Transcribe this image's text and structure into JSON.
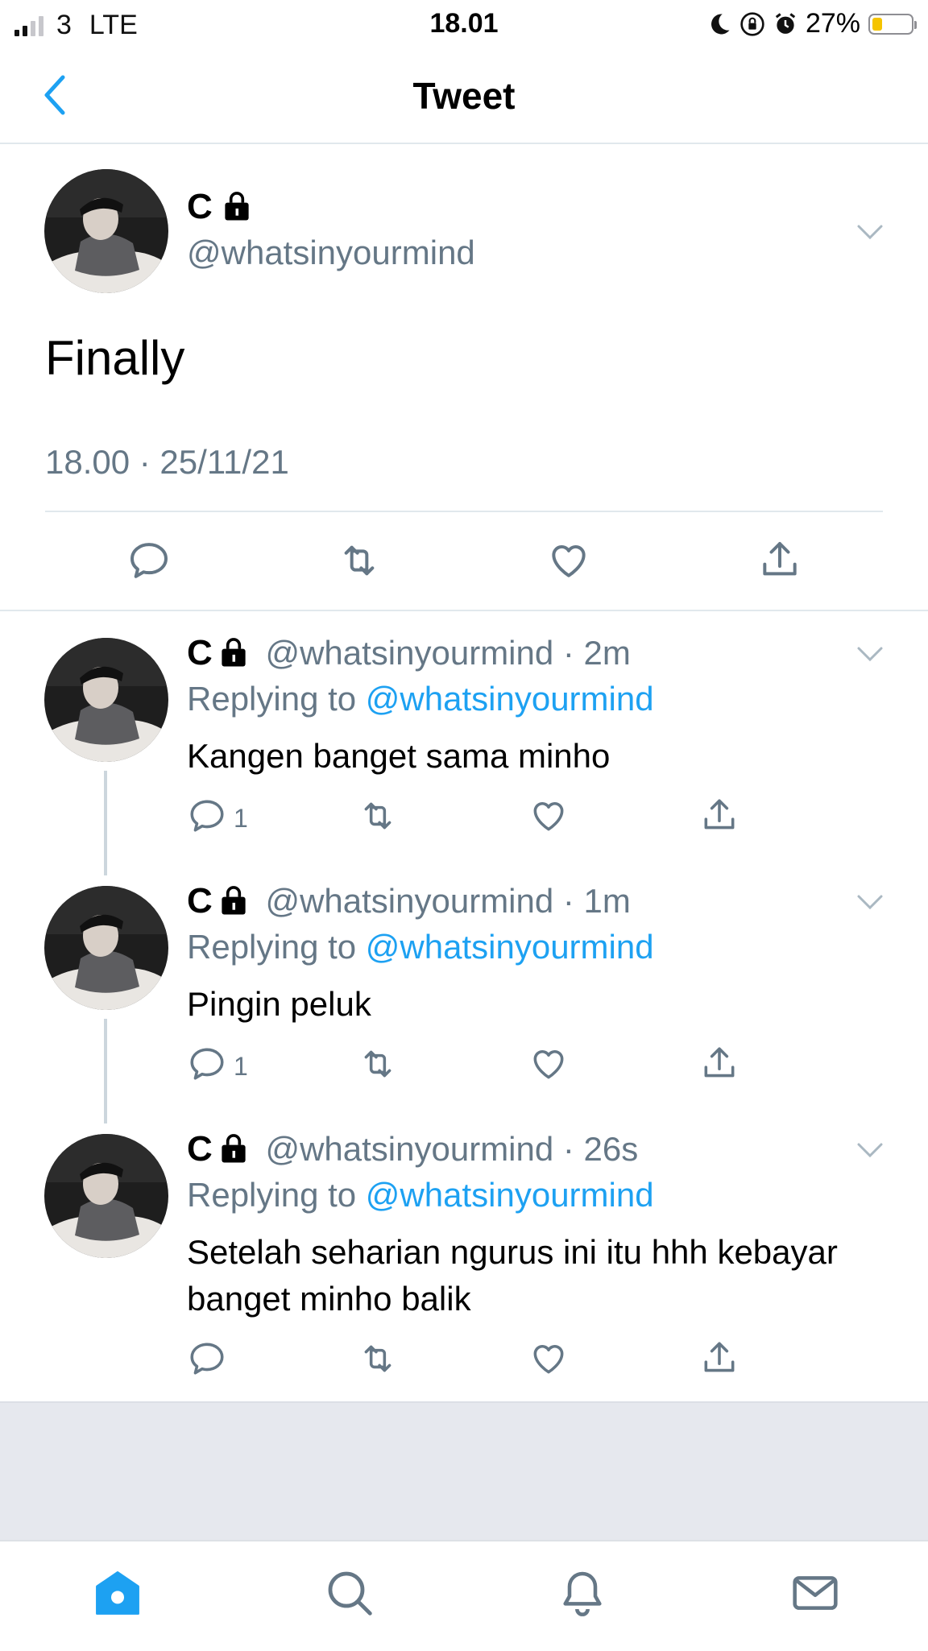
{
  "status_bar": {
    "carrier": "3",
    "network": "LTE",
    "time": "18.01",
    "battery_percent": "27%",
    "battery_level": 0.27,
    "battery_color": "#f5c400"
  },
  "nav": {
    "title": "Tweet",
    "back_icon": "chevron-left-icon"
  },
  "main_tweet": {
    "name": "C",
    "handle": "@whatsinyourmind",
    "text": "Finally",
    "timestamp": "18.00 · 25/11/21"
  },
  "replies": [
    {
      "name": "C",
      "handle": "@whatsinyourmind",
      "time": "· 2m",
      "replying_label": "Replying to",
      "replying_to": "@whatsinyourmind",
      "text": "Kangen banget sama minho",
      "reply_count": "1"
    },
    {
      "name": "C",
      "handle": "@whatsinyourmind",
      "time": "· 1m",
      "replying_label": "Replying to",
      "replying_to": "@whatsinyourmind",
      "text": "Pingin peluk",
      "reply_count": "1"
    },
    {
      "name": "C",
      "handle": "@whatsinyourmind",
      "time": "· 26s",
      "replying_label": "Replying to",
      "replying_to": "@whatsinyourmind",
      "text": "Setelah seharian ngurus ini itu hhh kebayar banget minho balik",
      "reply_count": ""
    }
  ],
  "tab_bar": [
    "home-icon",
    "search-icon",
    "notifications-icon",
    "messages-icon"
  ],
  "colors": {
    "accent": "#1da1f2",
    "secondary_text": "#657786",
    "divider": "#e1e8ed",
    "icon_gray": "#657786"
  }
}
